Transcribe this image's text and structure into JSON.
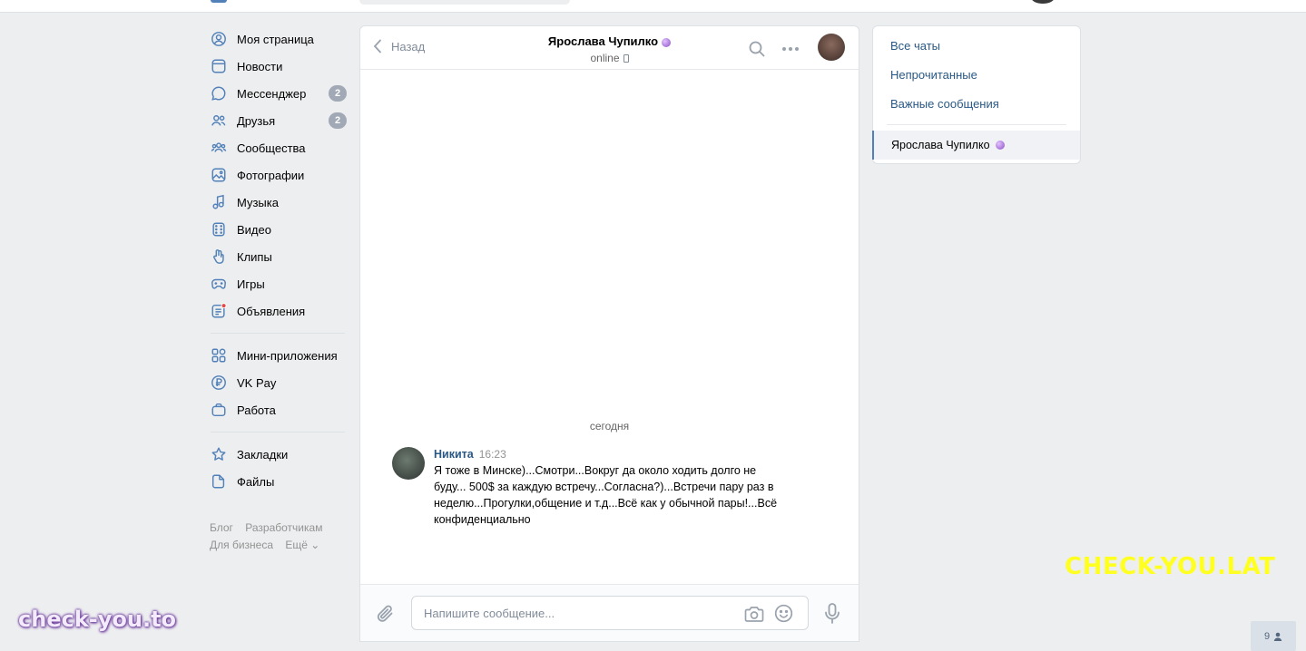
{
  "nav": {
    "items": [
      {
        "label": "Моя страница",
        "icon": "user-circle-icon"
      },
      {
        "label": "Новости",
        "icon": "news-icon"
      },
      {
        "label": "Мессенджер",
        "icon": "chat-bubble-icon",
        "badge": "2"
      },
      {
        "label": "Друзья",
        "icon": "friends-icon",
        "badge": "2"
      },
      {
        "label": "Сообщества",
        "icon": "groups-icon"
      },
      {
        "label": "Фотографии",
        "icon": "photo-icon"
      },
      {
        "label": "Музыка",
        "icon": "music-icon"
      },
      {
        "label": "Видео",
        "icon": "video-icon"
      },
      {
        "label": "Клипы",
        "icon": "clips-icon"
      },
      {
        "label": "Игры",
        "icon": "gamepad-icon"
      },
      {
        "label": "Объявления",
        "icon": "ads-icon"
      }
    ],
    "items2": [
      {
        "label": "Мини-приложения",
        "icon": "apps-icon"
      },
      {
        "label": "VK Pay",
        "icon": "vkpay-icon"
      },
      {
        "label": "Работа",
        "icon": "briefcase-icon"
      }
    ],
    "items3": [
      {
        "label": "Закладки",
        "icon": "star-icon"
      },
      {
        "label": "Файлы",
        "icon": "file-icon"
      }
    ],
    "footer": {
      "blog": "Блог",
      "dev": "Разработчикам",
      "business": "Для бизнеса",
      "more": "Ещё ⌄"
    }
  },
  "chat": {
    "back_label": "Назад",
    "peer_name": "Ярослава Чупилко",
    "peer_status": "online",
    "day_separator": "сегодня",
    "message": {
      "author": "Никита",
      "time": "16:23",
      "text": "Я тоже в Минске)...Смотри...Вокруг да около ходить долго не буду... 500$ за каждую встречу...Согласна?)...Встречи пару раз в неделю...Прогулки,общение и т.д...Всё как у обычной пары!...Всё конфиденциально"
    },
    "composer_placeholder": "Напишите сообщение..."
  },
  "right_panel": {
    "filters": [
      "Все чаты",
      "Непрочитанные",
      "Важные сообщения"
    ],
    "active_chat": "Ярослава Чупилко"
  },
  "watermarks": {
    "yellow": "CHECK-YOU.LAT",
    "purple": "check-you.to"
  },
  "online_count": "9",
  "colors": {
    "link": "#2a5885",
    "accent": "#5181b8",
    "badge": "#a0a9b5",
    "background": "#edeef0"
  }
}
